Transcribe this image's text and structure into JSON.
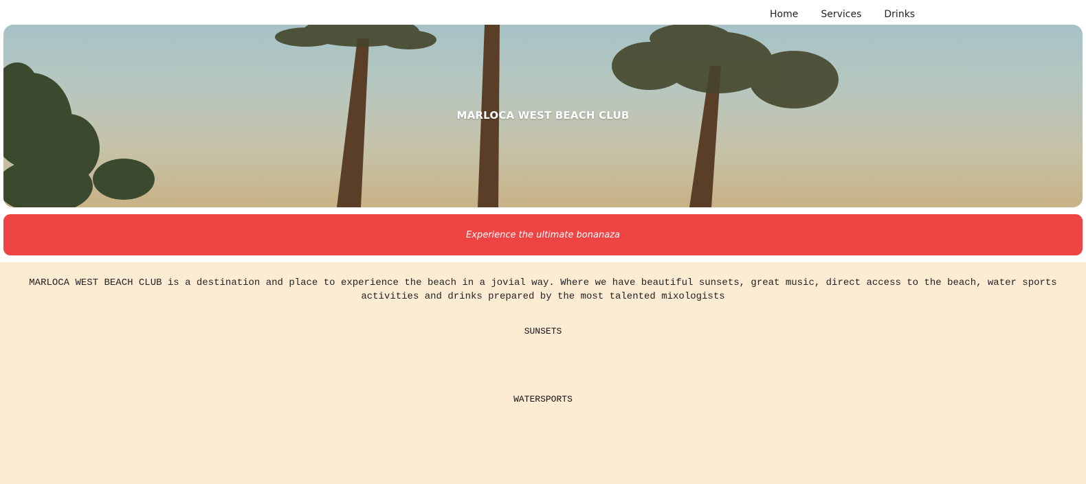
{
  "nav": {
    "items": [
      {
        "label": "Home"
      },
      {
        "label": "Services"
      },
      {
        "label": "Drinks"
      }
    ]
  },
  "hero": {
    "title": "MARLOCA WEST BEACH CLUB",
    "image_icon": "palm-trees-image"
  },
  "banner": {
    "tagline": "Experience the ultimate bonanaza"
  },
  "about": {
    "text": "MARLOCA WEST BEACH CLUB is a destination and place to experience the beach in a jovial way. Where we have beautiful sunsets, great music, direct access to the beach, water sports activities and drinks prepared by the most talented mixologists"
  },
  "sections": [
    {
      "heading": "SUNSETS"
    },
    {
      "heading": "WATERSPORTS"
    }
  ],
  "colors": {
    "banner": "#ef4444",
    "page_background": "#fcecd3",
    "header_background": "#ffffff"
  }
}
